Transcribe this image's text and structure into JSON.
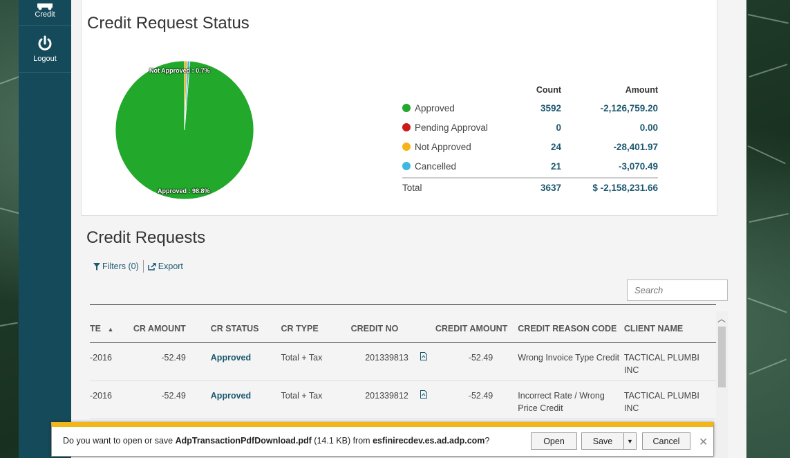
{
  "nav": {
    "items": [
      {
        "label": "Credit",
        "icon": "truck-icon"
      },
      {
        "label": "Logout",
        "icon": "power-icon"
      }
    ]
  },
  "status": {
    "title": "Credit Request Status",
    "pie_labels": {
      "not_approved": "Not Approved : 0.7%",
      "approved": "Approved : 98.8%"
    },
    "legend_header": {
      "count": "Count",
      "amount": "Amount"
    },
    "legend": [
      {
        "name": "Approved",
        "count": "3592",
        "amount": "-2,126,759.20",
        "color": "#22a82a"
      },
      {
        "name": "Pending Approval",
        "count": "0",
        "amount": "0.00",
        "color": "#cc1a1a"
      },
      {
        "name": "Not Approved",
        "count": "24",
        "amount": "-28,401.97",
        "color": "#f5b41a"
      },
      {
        "name": "Cancelled",
        "count": "21",
        "amount": "-3,070.49",
        "color": "#3db8e0"
      }
    ],
    "total": {
      "label": "Total",
      "count": "3637",
      "amount": "$ -2,158,231.66"
    }
  },
  "chart_data": {
    "type": "pie",
    "labels": [
      "Approved",
      "Pending Approval",
      "Not Approved",
      "Cancelled"
    ],
    "values": [
      3592,
      0,
      24,
      21
    ],
    "colors": [
      "#22a82a",
      "#cc1a1a",
      "#f5b41a",
      "#3db8e0"
    ]
  },
  "requests": {
    "title": "Credit Requests",
    "filters_label": "Filters (0)",
    "export_label": "Export",
    "search_placeholder": "Search",
    "columns": [
      "TE",
      "CR AMOUNT",
      "CR STATUS",
      "CR TYPE",
      "CREDIT NO",
      "",
      "CREDIT AMOUNT",
      "CREDIT REASON CODE",
      "CLIENT NAME"
    ],
    "rows": [
      {
        "date": "-2016",
        "cr_amount": "-52.49",
        "status": "Approved",
        "type": "Total + Tax",
        "credit_no": "201339813",
        "credit_amount": "-52.49",
        "reason": "Wrong Invoice Type Credit",
        "client": "TACTICAL PLUMBI INC"
      },
      {
        "date": "-2016",
        "cr_amount": "-52.49",
        "status": "Approved",
        "type": "Total + Tax",
        "credit_no": "201339812",
        "credit_amount": "-52.49",
        "reason": "Incorrect Rate / Wrong Price Credit",
        "client": "TACTICAL PLUMBI INC"
      }
    ]
  },
  "download": {
    "prefix": "Do you want to open or save ",
    "filename": "AdpTransactionPdfDownload.pdf",
    "size": " (14.1 KB) from ",
    "host": "esfinirecdev.es.ad.adp.com",
    "suffix": "?",
    "open_label": "Open",
    "save_label": "Save",
    "cancel_label": "Cancel"
  }
}
